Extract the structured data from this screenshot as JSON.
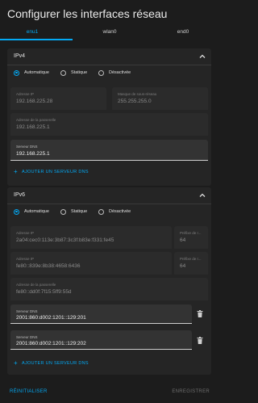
{
  "dialog": {
    "title": "Configurer les interfaces réseau"
  },
  "tabs": [
    {
      "label": "enu1"
    },
    {
      "label": "wlan0"
    },
    {
      "label": "end0"
    }
  ],
  "ipv4": {
    "header": "IPv4",
    "modes": [
      "Automatique",
      "Statique",
      "Désactivée"
    ],
    "ip": {
      "label": "Adresse IP",
      "value": "192.168.225.28"
    },
    "mask": {
      "label": "Masque de sous-réseau",
      "value": "255.255.255.0"
    },
    "gateway": {
      "label": "Adresse de la passerelle",
      "value": "192.168.225.1"
    },
    "dns": {
      "label": "Serveur DNS",
      "value": "192.168.225.1"
    },
    "add_dns": "AJOUTER UN SERVEUR DNS"
  },
  "ipv6": {
    "header": "IPv6",
    "modes": [
      "Automatique",
      "Statique",
      "Désactivée"
    ],
    "ip1": {
      "label": "Adresse IP",
      "value": "2a04:cec0:113e:3b87:3c3f:b83e:f331:fe45"
    },
    "prefix1": {
      "label": "Préfixe de r...",
      "value": "64"
    },
    "ip2": {
      "label": "Adresse IP",
      "value": "fe80::839e:8b38:4658:6436"
    },
    "prefix2": {
      "label": "Préfixe de r...",
      "value": "64"
    },
    "gateway": {
      "label": "Adresse de la passerelle",
      "value": "fe80::dd0f:7f15:5ff9:55d"
    },
    "dns1": {
      "label": "Serveur DNS",
      "value": "2001:860:d002:1201::129:201"
    },
    "dns2": {
      "label": "Serveur DNS",
      "value": "2001:860:d002:1201::129:202"
    },
    "add_dns": "AJOUTER UN SERVEUR DNS"
  },
  "footer": {
    "reset": "RÉINITIALISER",
    "save": "ENREGISTRER"
  },
  "colors": {
    "accent": "#03a9f4",
    "background": "#1c1c1c",
    "card": "#252525"
  }
}
